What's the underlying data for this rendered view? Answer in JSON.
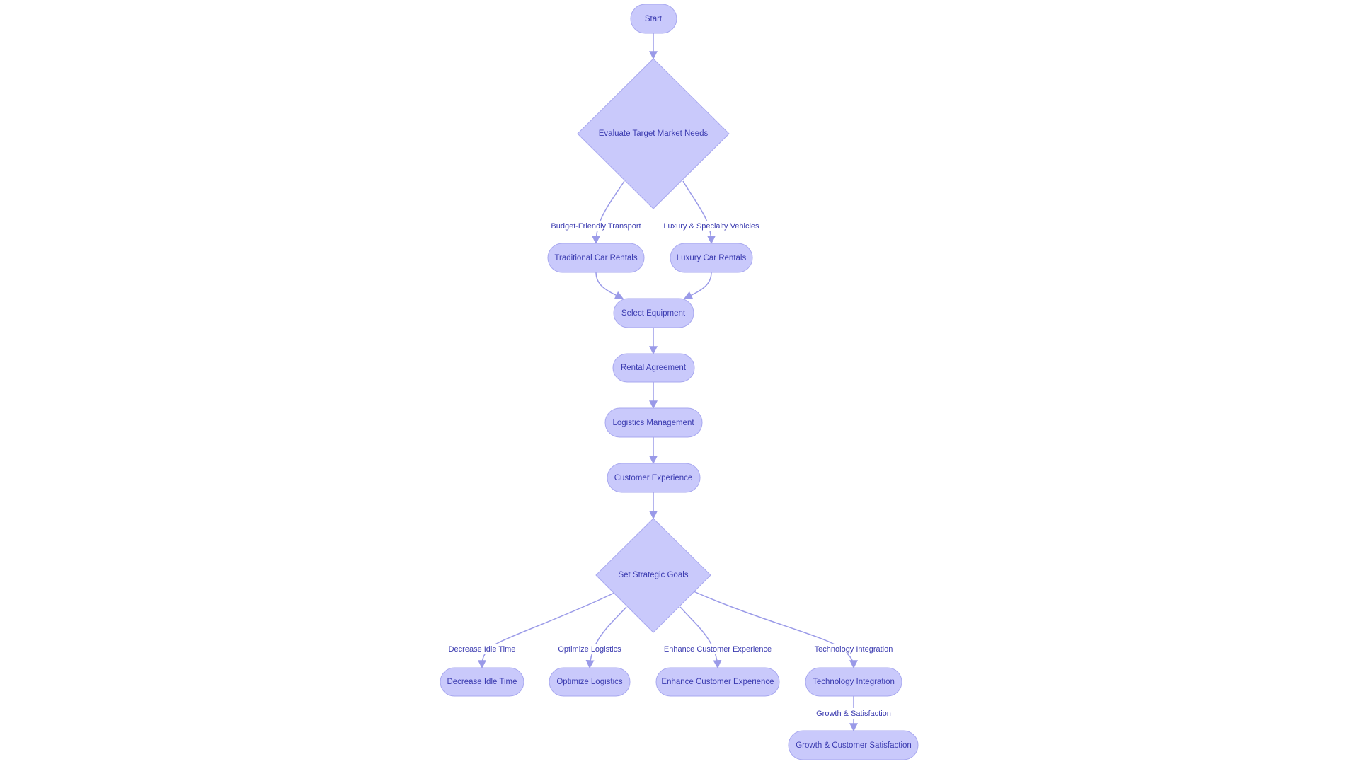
{
  "colors": {
    "node_fill": "#c9c9fb",
    "node_stroke": "#a8a8ef",
    "text": "#3b3bb0",
    "edge": "#9a9ae8"
  },
  "nodes": {
    "start": "Start",
    "evaluate": "Evaluate Target Market Needs",
    "traditional": "Traditional Car Rentals",
    "luxury": "Luxury Car Rentals",
    "select": "Select Equipment",
    "agreement": "Rental Agreement",
    "logistics": "Logistics Management",
    "customer": "Customer Experience",
    "goals": "Set Strategic Goals",
    "idle": "Decrease Idle Time",
    "optimize": "Optimize Logistics",
    "enhance": "Enhance Customer Experience",
    "tech": "Technology Integration",
    "growth": "Growth & Customer Satisfaction"
  },
  "edge_labels": {
    "budget": "Budget-Friendly Transport",
    "luxury": "Luxury & Specialty Vehicles",
    "idle": "Decrease Idle Time",
    "optimize": "Optimize Logistics",
    "enhance": "Enhance Customer Experience",
    "tech": "Technology Integration",
    "growth": "Growth & Satisfaction"
  }
}
